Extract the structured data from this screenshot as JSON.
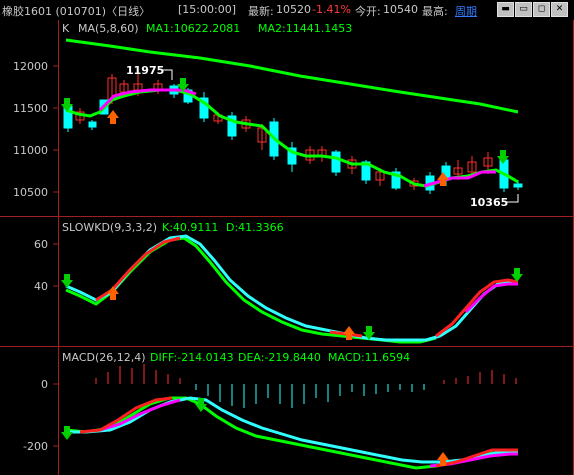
{
  "topbar": {
    "title": "橡胶1601 (010701)〈日线〉",
    "time": "[15:00:00]",
    "latest_label": "最新:",
    "latest_value": "10520",
    "change": "-1.41%",
    "open_label": "今开:",
    "open_value": "10540",
    "high_label": "最高:",
    "period_link": "周期",
    "window_buttons": [
      "minimize-icon",
      "restore-icon",
      "maximize-icon",
      "close-icon"
    ]
  },
  "main_panel": {
    "prefix": "K",
    "indicator": "MA(5,8,60)",
    "ma1_text": "MA1:10622.2081",
    "ma2_text": "MA2:11441.1453",
    "y_ticks": [
      "12000",
      "11500",
      "11000",
      "10500"
    ],
    "high_label": "11975",
    "low_label": "10365"
  },
  "kd_panel": {
    "indicator": "SLOWKD(9,3,3,2)",
    "k_text": "K:40.9111",
    "d_text": "D:41.3366",
    "y_ticks": [
      "60",
      "40"
    ]
  },
  "macd_panel": {
    "indicator": "MACD(26,12,4)",
    "diff_text": "DIFF:-214.0143",
    "dea_text": "DEA:-219.8440",
    "macd_text": "MACD:11.6594",
    "y_ticks": [
      "0",
      "-200"
    ]
  },
  "colors": {
    "up": "#ff3030",
    "down": "#00ffff",
    "ma_green": "#00ff00",
    "ma_magenta": "#ff00ff",
    "kd_red": "#ff2020",
    "kd_cyan": "#30ffff",
    "text": "#c8c8c8",
    "frame": "#a02020"
  }
}
